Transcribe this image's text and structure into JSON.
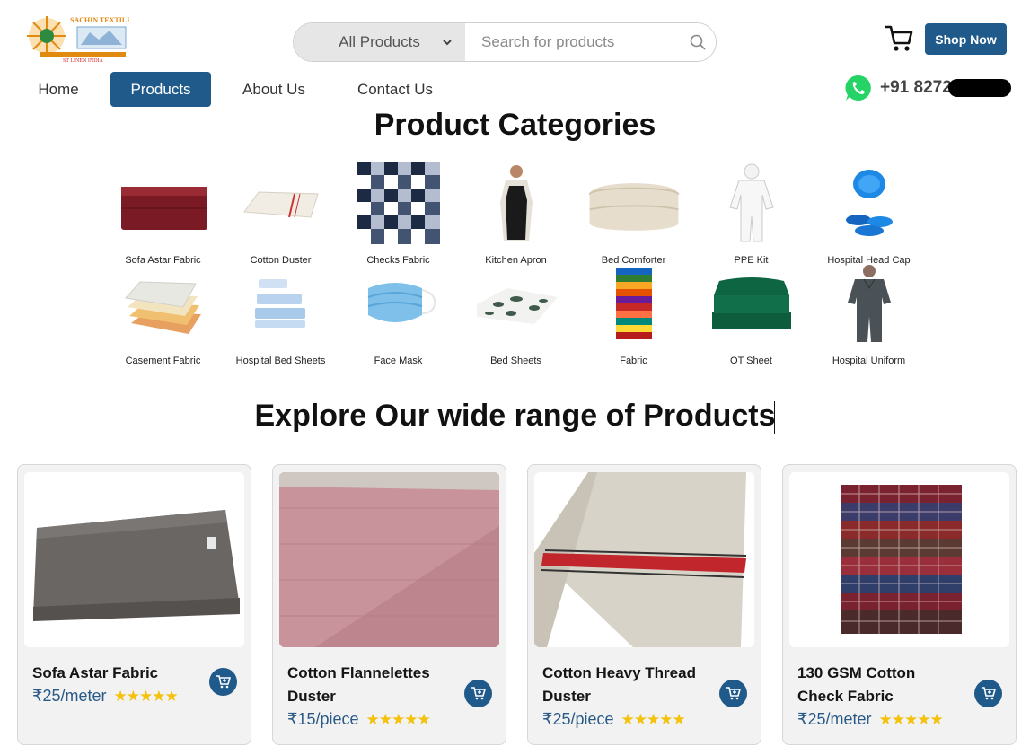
{
  "brand": {
    "logo_top": "SACHIN TEXTILES",
    "logo_bottom": "ST LINEN INDIA"
  },
  "search": {
    "category": "All Products",
    "placeholder": "Search for products"
  },
  "header": {
    "shop_now": "Shop Now",
    "phone": "+91 8272"
  },
  "nav": [
    {
      "label": "Home",
      "active": false
    },
    {
      "label": "Products",
      "active": true
    },
    {
      "label": "About Us",
      "active": false
    },
    {
      "label": "Contact Us",
      "active": false
    }
  ],
  "categories_title": "Product Categories",
  "categories": [
    {
      "label": "Sofa Astar Fabric",
      "icon": "folded-maroon-fabric"
    },
    {
      "label": "Cotton Duster",
      "icon": "white-duster-cloth"
    },
    {
      "label": "Checks Fabric",
      "icon": "checks-fabric"
    },
    {
      "label": "Kitchen Apron",
      "icon": "kitchen-apron"
    },
    {
      "label": "Bed Comforter",
      "icon": "bed-comforter"
    },
    {
      "label": "PPE Kit",
      "icon": "ppe-kit"
    },
    {
      "label": "Hospital Head Cap",
      "icon": "blue-head-caps"
    },
    {
      "label": "Casement Fabric",
      "icon": "stacked-casement-fabric"
    },
    {
      "label": "Hospital Bed Sheets",
      "icon": "blue-bed-sheets"
    },
    {
      "label": "Face Mask",
      "icon": "face-mask"
    },
    {
      "label": "Bed Sheets",
      "icon": "printed-bed-sheets"
    },
    {
      "label": "Fabric",
      "icon": "colorful-fabric-stack"
    },
    {
      "label": "OT Sheet",
      "icon": "green-ot-sheet"
    },
    {
      "label": "Hospital Uniform",
      "icon": "hospital-uniform"
    }
  ],
  "explore_title": "Explore Our wide range of Products",
  "products": [
    {
      "name": "Sofa Astar Fabric",
      "price": "₹25/meter",
      "stars": "★★★★★",
      "rating": 5,
      "image": "grey-fabric-stack"
    },
    {
      "name": "Cotton Flannelettes Duster",
      "price": "₹15/piece",
      "stars": "★★★★★",
      "rating": 5,
      "image": "pink-flannel-duster"
    },
    {
      "name": "Cotton Heavy Thread Duster",
      "price": "₹25/piece",
      "stars": "★★★★★",
      "rating": 5,
      "image": "striped-heavy-duster"
    },
    {
      "name": "130 GSM Cotton Check Fabric",
      "price": "₹25/meter",
      "stars": "★★★★★",
      "rating": 5,
      "image": "check-fabric-stack"
    }
  ],
  "colors": {
    "primary": "#1f5a8a",
    "star": "#f4c20d",
    "card_bg": "#f2f2f2",
    "whatsapp": "#25d366"
  }
}
